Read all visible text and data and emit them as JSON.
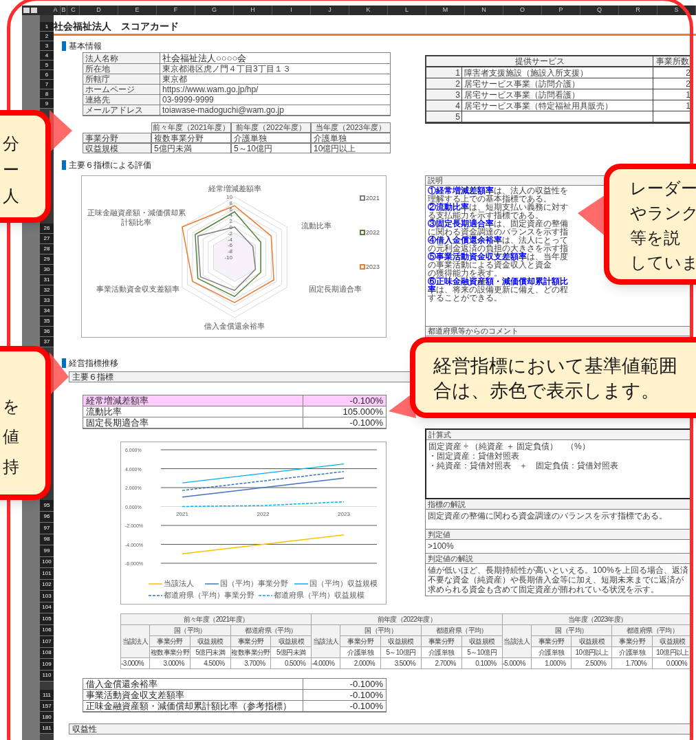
{
  "sheet": {
    "columns": [
      "A",
      "B",
      "C",
      "D",
      "E",
      "F",
      "G",
      "H",
      "I",
      "J",
      "K",
      "L",
      "M",
      "N",
      "O",
      "P",
      "Q",
      "R",
      "S"
    ],
    "row_header_groups": [
      {
        "labels": [
          "1",
          "2",
          "3",
          "4",
          "5",
          "6",
          "7",
          "8",
          "9"
        ]
      },
      {
        "labels": [
          "26",
          "27",
          "28",
          "29",
          "30",
          "31",
          "32",
          "33",
          "34",
          "35",
          "36",
          "37"
        ]
      },
      {
        "labels": [
          "95",
          "96",
          "97",
          "98",
          "99",
          "100",
          "101",
          "102",
          "103",
          "104",
          "105",
          "106",
          "107",
          "108",
          "109",
          "110"
        ]
      },
      {
        "labels": [
          "111",
          "157",
          "180",
          "181"
        ]
      }
    ],
    "title": "社会福祉法人　スコアカード",
    "basic_info": {
      "heading": "基本情報",
      "rows": [
        {
          "label": "法人名称",
          "value": "社会福祉法人○○○○会"
        },
        {
          "label": "所在地",
          "value": "東京都港区虎ノ門４丁目3丁目１３"
        },
        {
          "label": "所轄庁",
          "value": "東京都"
        },
        {
          "label": "ホームページ",
          "value": "https://www.wam.go.jp/hp/"
        },
        {
          "label": "連絡先",
          "value": "03-9999-9999"
        },
        {
          "label": "メールアドレス",
          "value": "toiawase-madoguchi@wam.go.jp"
        }
      ],
      "year_table": {
        "columns": [
          "前々年度（2021年度）",
          "前年度（2022年度）",
          "当年度（2023年度）"
        ],
        "rows": [
          {
            "label": "事業分野",
            "values": [
              "複数事業分野",
              "介護単独",
              "介護単独"
            ]
          },
          {
            "label": "収益規模",
            "values": [
              "5億円未満",
              "5～10億円",
              "10億円以上"
            ]
          }
        ]
      }
    },
    "services": {
      "columns": [
        "提供サービス",
        "事業所数"
      ],
      "rows": [
        {
          "no": "1",
          "name": "障害者支援施設（施設入所支援）",
          "count": "2"
        },
        {
          "no": "2",
          "name": "居宅サービス事業（訪問介護）",
          "count": "2"
        },
        {
          "no": "3",
          "name": "居宅サービス事業（訪問看護）",
          "count": "1"
        },
        {
          "no": "4",
          "name": "居宅サービス事業（特定福祉用具販売）",
          "count": "1"
        },
        {
          "no": "5"
        }
      ]
    },
    "evaluation": {
      "heading": "主要６指標による評価",
      "axes": [
        "経常増減差額率",
        "正味金融資産額・減価償却累計額比率",
        "流動比率",
        "事業活動資金収支差額率",
        "固定長期適合率",
        "借入金償還余裕率"
      ],
      "ticks": [
        "10",
        "8",
        "6",
        "4",
        "2",
        "0",
        "-2",
        "-4",
        "-6",
        "-8",
        "-10"
      ],
      "legend": [
        {
          "label": "2021",
          "color": "#7f7f7f"
        },
        {
          "label": "2022",
          "color": "#548235"
        },
        {
          "label": "2023",
          "color": "#ed7d31"
        }
      ]
    },
    "explanation": {
      "header": "説明",
      "items": [
        {
          "term": "①経常増減差額率",
          "text": "は、法人の収益性を理解する上での基本指標である。"
        },
        {
          "term": "②流動比率",
          "text": "は、短期支払い義務に対する支払能力を示す指標である。"
        },
        {
          "term": "③固定長期適合率",
          "text": "は、固定資産の整備に関わる資金調達のバランスを示す指"
        },
        {
          "term": "④借入金償還余裕率",
          "text": "は、法人にとっての元利金返済の負担の大きさを示す指"
        },
        {
          "term": "⑤事業活動資金収支差額率",
          "text": "は、当年度の事業活動による資金収入と資金"
        },
        {
          "text": "の獲得能力を表す。"
        },
        {
          "term": "⑥正味金融資産額・減価償却累計額比率",
          "text": "は、将来の設備更新に備え、どの程"
        },
        {
          "text": "することができる。"
        }
      ]
    },
    "comment": {
      "header": "都道府県等からのコメント"
    },
    "trend": {
      "heading": "経営指標推移",
      "bar": "主要６指標",
      "indicators": [
        {
          "name": "経常増減差額率",
          "value": "-0.100%",
          "flagged": true
        },
        {
          "name": "流動比率",
          "value": "105.000%",
          "flagged": false
        },
        {
          "name": "固定長期適合率",
          "value": "-0.100%",
          "flagged": false
        }
      ],
      "chart_data": {
        "type": "line",
        "categories": [
          "2021",
          "2022",
          "2023"
        ],
        "ylim": [
          -6,
          6
        ],
        "grid": true,
        "legend": true,
        "yticks": [
          {
            "value": 6,
            "label": "6.000%"
          },
          {
            "value": 4,
            "label": "4.000%"
          },
          {
            "value": 2,
            "label": "2.000%"
          },
          {
            "value": 0,
            "label": "0.000%"
          },
          {
            "value": -2,
            "label": "-2.000%"
          },
          {
            "value": -4,
            "label": "-4.000%"
          },
          {
            "value": -6,
            "label": "-6.000%"
          }
        ],
        "series": [
          {
            "name": "当該法人",
            "color": "#ffc000",
            "line_style": "solid",
            "values": [
              -5,
              -4,
              -3
            ]
          },
          {
            "name": "国（平均）事業分野",
            "color": "#4472c4",
            "line_style": "solid",
            "values": [
              1,
              2,
              3
            ]
          },
          {
            "name": "国（平均）収益規模",
            "color": "#00b0f0",
            "line_style": "solid",
            "values": [
              2.5,
              3.5,
              4.5
            ]
          },
          {
            "name": "都道府県（平均）事業分野",
            "color": "#2e75b6",
            "line_style": "dashed",
            "values": [
              1.7,
              2.7,
              3.7
            ]
          },
          {
            "name": "都道府県（平均）収益規模",
            "color": "#00b0f0",
            "line_style": "dashed",
            "values": [
              0,
              0.1,
              0.5
            ]
          }
        ]
      },
      "detail": [
        {
          "header": "計算式",
          "lines": [
            "固定資産 ÷ （純資産 ＋ 固定負債）　（%）",
            "・固定資産：貸借対照表",
            "・純資産：貸借対照表　＋　固定負債：貸借対照表"
          ],
          "selected": true
        },
        {
          "header": "指標の解説",
          "lines": [
            "固定資産の整備に関わる資金調達のバランスを示す指標である。"
          ],
          "selected": false
        },
        {
          "header": "判定値",
          "lines": [
            ">100%"
          ],
          "selected": false
        },
        {
          "header": "判定値の解説",
          "lines": [
            "値が低いほど、長期持続性が高いといえる。100%を上回る場合、返済不要な資金（純資産）や長期借入金等に加え、短期未来までに返済が求められる資金も含めて固定資産が賄われている状況を示す。"
          ],
          "selected": false
        }
      ],
      "table": {
        "groups": [
          {
            "year": "前々年度（2021年度）",
            "self": "当該法人",
            "subgroups": [
              {
                "label": "国（平均）",
                "heads": [
                  "事業分野",
                  "収益規模"
                ],
                "subs": [
                  "複数事業分野",
                  "5億円未満"
                ]
              },
              {
                "label": "都道府県（平均）",
                "heads": [
                  "事業分野",
                  "収益規模"
                ],
                "subs": [
                  "複数事業分野",
                  "5億円未満"
                ]
              }
            ],
            "values": [
              "-3.000%",
              "3.000%",
              "4.500%",
              "3.700%",
              "0.500%"
            ]
          },
          {
            "year": "前年度（2022年度）",
            "self": "当該法人",
            "subgroups": [
              {
                "label": "国（平均）",
                "heads": [
                  "事業分野",
                  "収益規模"
                ],
                "subs": [
                  "介護単独",
                  "5～10億円"
                ]
              },
              {
                "label": "都道府県（平均）",
                "heads": [
                  "事業分野",
                  "収益規模"
                ],
                "subs": [
                  "介護単独",
                  "5～10億円"
                ]
              }
            ],
            "values": [
              "-4.000%",
              "2.000%",
              "3.500%",
              "2.700%",
              "0.100%"
            ]
          },
          {
            "year": "当年度（2023年度）",
            "self": "当該法人",
            "subgroups": [
              {
                "label": "国（平均）",
                "heads": [
                  "事業分野",
                  "収益規模"
                ],
                "subs": [
                  "介護単独",
                  "10億円以上"
                ]
              },
              {
                "label": "都道府県（平均）",
                "heads": [
                  "事業分野",
                  "収益規模"
                ],
                "subs": [
                  "介護単独",
                  "10億円以上"
                ]
              }
            ],
            "values": [
              "-5.000%",
              "1.000%",
              "2.500%",
              "1.700%",
              "0.000%"
            ]
          }
        ]
      },
      "indicators_2": [
        {
          "name": "借入金償還余裕率",
          "value": "-0.100%",
          "flagged": false
        },
        {
          "name": "事業活動資金収支差額率",
          "value": "-0.100%",
          "flagged": false
        },
        {
          "name": "正味金融資産額・減価償却累計額比率（参考指標）",
          "value": "-0.100%",
          "flagged": false
        }
      ],
      "next_bar": "収益性"
    }
  },
  "callouts": [
    {
      "lines": [
        "分",
        "ー",
        "人"
      ]
    },
    {
      "lines": [
        "を",
        "値",
        "持"
      ]
    },
    {
      "lines": [
        "レーダー",
        "やランク",
        "等を説",
        "していま"
      ]
    },
    {
      "lines": [
        "経営指標において基準値範囲",
        "合は、赤色で表示します。"
      ]
    }
  ]
}
